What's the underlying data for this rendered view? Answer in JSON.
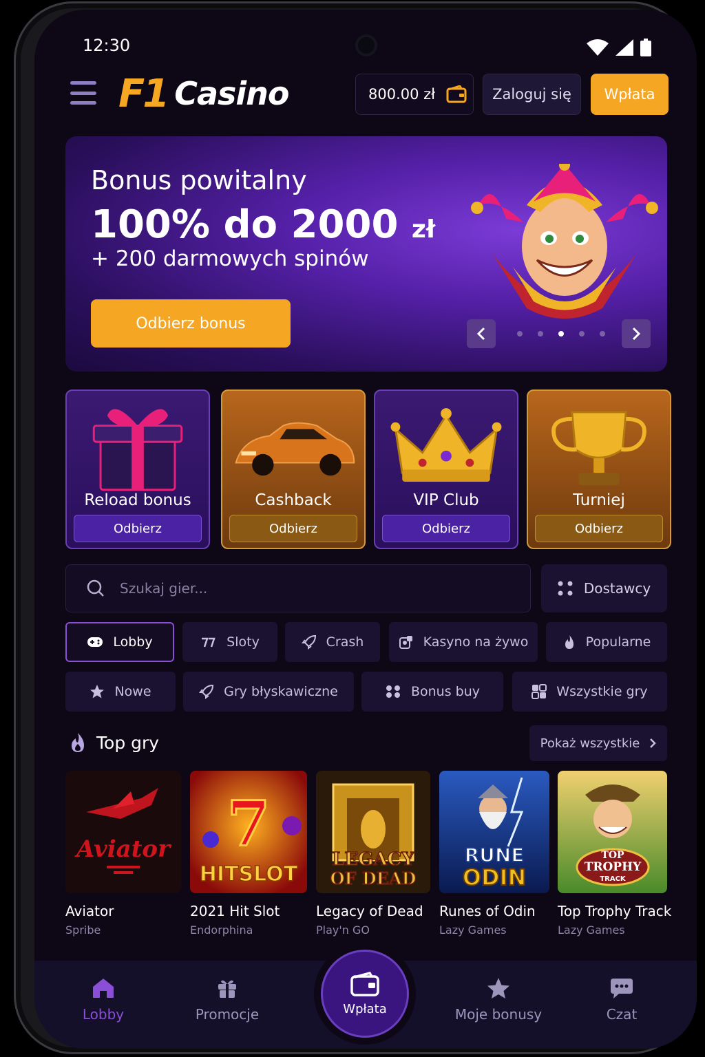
{
  "status_bar": {
    "time": "12:30"
  },
  "header": {
    "logo_f1": "F1",
    "logo_casino": "Casino",
    "balance": "800.00 zł",
    "login_label": "Zaloguj się",
    "deposit_label": "Wpłata"
  },
  "hero": {
    "title": "Bonus powitalny",
    "headline": "100% do 2000",
    "headline_currency": "zł",
    "subline": "+ 200 darmowych spinów",
    "cta_label": "Odbierz bonus",
    "carousel_total": 5,
    "carousel_active_index": 3
  },
  "promos": [
    {
      "label": "Reload bonus",
      "button": "Odbierz",
      "style": "purple"
    },
    {
      "label": "Cashback",
      "button": "Odbierz",
      "style": "gold"
    },
    {
      "label": "VIP Club",
      "button": "Odbierz",
      "style": "purple"
    },
    {
      "label": "Turniej",
      "button": "Odbierz",
      "style": "gold"
    }
  ],
  "search": {
    "placeholder": "Szukaj gier...",
    "providers_label": "Dostawcy"
  },
  "categories": {
    "row1": [
      {
        "label": "Lobby",
        "icon": "gamepad-icon",
        "active": true
      },
      {
        "label": "Sloty",
        "icon": "slot-icon"
      },
      {
        "label": "Crash",
        "icon": "rocket-icon"
      },
      {
        "label": "Kasyno na żywo",
        "icon": "live-icon"
      },
      {
        "label": "Popularne",
        "icon": "fire-icon"
      }
    ],
    "row2": [
      {
        "label": "Nowe",
        "icon": "star-icon"
      },
      {
        "label": "Gry błyskawiczne",
        "icon": "rocket-icon"
      },
      {
        "label": "Bonus buy",
        "icon": "bonus-icon"
      },
      {
        "label": "Wszystkie gry",
        "icon": "grid-icon"
      }
    ]
  },
  "top_games": {
    "title": "Top gry",
    "show_all_label": "Pokaż wszystkie",
    "games": [
      {
        "name": "Aviator",
        "provider": "Spribe",
        "art_text": "Aviator"
      },
      {
        "name": "2021 Hit Slot",
        "provider": "Endorphina",
        "art_text": "HITSLOT",
        "art_badge": "7"
      },
      {
        "name": "Legacy of Dead",
        "provider": "Play'n GO",
        "art_text": "LEGACY",
        "art_text2": "OF DEAD"
      },
      {
        "name": "Runes of Odin",
        "provider": "Lazy Games",
        "art_text": "RUNE",
        "art_text2": "ODIN"
      },
      {
        "name": "Top Trophy Track",
        "provider": "Lazy Games",
        "art_text": "TOP",
        "art_text2": "TROPHY",
        "art_text3": "TRACK"
      }
    ]
  },
  "bottom_nav": {
    "lobby": "Lobby",
    "promos": "Promocje",
    "deposit": "Wpłata",
    "my_bonuses": "Moje bonusy",
    "chat": "Czat"
  },
  "colors": {
    "accent": "#f5a623",
    "purple": "#8a4fd6",
    "background": "#0d0716"
  }
}
